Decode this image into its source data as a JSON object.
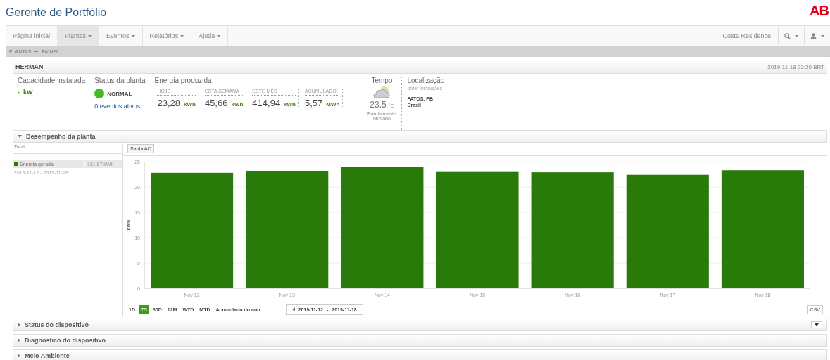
{
  "app_title": "Gerente de Portfólio",
  "logo": "AB",
  "nav": [
    {
      "label": "Página inicial",
      "selected": false,
      "dropdown": false
    },
    {
      "label": "Plantas",
      "selected": true,
      "dropdown": true
    },
    {
      "label": "Eventos",
      "selected": false,
      "dropdown": true
    },
    {
      "label": "Relatórios",
      "selected": false,
      "dropdown": true
    },
    {
      "label": "Ajuda",
      "selected": false,
      "dropdown": true
    }
  ],
  "portfolio_name": "Costa Residence",
  "breadcrumb": [
    "PLANTAS",
    "PAINEL"
  ],
  "plant": {
    "name": "HERMAN",
    "timestamp": "2019-11-18 23:20 BRT"
  },
  "capacity": {
    "label": "Capacidade instalada",
    "value": "-",
    "unit": "kW"
  },
  "status": {
    "label": "Status da planta",
    "value": "NORMAL",
    "color": "#44bb22",
    "events_link": "0 eventos ativos"
  },
  "energy": {
    "label": "Energia produzida",
    "items": [
      {
        "label": "HOJE",
        "value": "23,28",
        "unit": "kWh"
      },
      {
        "label": "ESTA SEMANA",
        "value": "45,66",
        "unit": "kWh"
      },
      {
        "label": "ESTE MÊS",
        "value": "414,94",
        "unit": "kWh"
      },
      {
        "label": "ACUMULADO",
        "value": "5,57",
        "unit": "MWh"
      }
    ]
  },
  "weather": {
    "label": "Tempo",
    "temperature": "23.5",
    "unit": "°C",
    "condition": "Parcialmente nublado"
  },
  "location": {
    "label": "Localização",
    "hint": "obter instruções",
    "city": "PATOS, PB",
    "country": "Brasil"
  },
  "performance": {
    "title": "Desempenho da planta",
    "expanded": true,
    "total_label": "Total",
    "total_value": "161,87 kWh",
    "range_text": "2019-11-12 - 2019-11-18",
    "chart_tab": "Saída AC",
    "chart_data": {
      "type": "bar",
      "ylabel": "kWh",
      "grid": true,
      "categories": [
        "Nov 12",
        "Nov 13",
        "Nov 14",
        "Nov 15",
        "Nov 16",
        "Nov 17",
        "Nov 18"
      ],
      "series": [
        {
          "name": "Energia gerada",
          "color": "#2a7a0a",
          "values": [
            22.8,
            23.2,
            23.9,
            23.1,
            22.9,
            22.4,
            23.3
          ]
        }
      ],
      "ylim": [
        0,
        25
      ],
      "yticks": [
        0,
        5,
        10,
        15,
        20,
        25
      ]
    },
    "periods": [
      {
        "label": "1D",
        "selected": false
      },
      {
        "label": "7D",
        "selected": true
      },
      {
        "label": "30D",
        "selected": false
      },
      {
        "label": "12M",
        "selected": false
      },
      {
        "label": "WTD",
        "selected": false
      },
      {
        "label": "MTD",
        "selected": false
      },
      {
        "label": "Acumulado do ano",
        "selected": false
      }
    ],
    "date_range": {
      "start": "2019-11-12",
      "separator": "-",
      "end": "2019-11-18"
    },
    "csv_button": "CSV"
  },
  "sections": [
    {
      "title": "Status do dispositivo",
      "expanded": false,
      "menu": true
    },
    {
      "title": "Diagnóstico do dispositivo",
      "expanded": false,
      "menu": false
    },
    {
      "title": "Meio Ambiente",
      "expanded": false,
      "menu": false
    }
  ]
}
